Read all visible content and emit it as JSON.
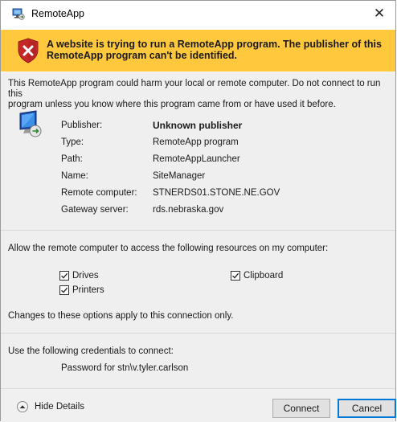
{
  "window": {
    "title": "RemoteApp",
    "close_glyph": "✕"
  },
  "banner": {
    "line1": "A website is trying to run a RemoteApp program. The publisher of this",
    "line2": "RemoteApp program can't be identified.",
    "color": "#ffc83d",
    "icon": "shield-error-icon"
  },
  "warning": {
    "line1": "This RemoteApp program could harm your local or remote computer. Do not connect to run this",
    "line2": "program unless you know where this program came from or have used it before."
  },
  "details": {
    "icon": "remote-computer-icon",
    "rows": [
      {
        "label": "Publisher:",
        "value": "Unknown publisher"
      },
      {
        "label": "Type:",
        "value": "RemoteApp program"
      },
      {
        "label": "Path:",
        "value": "RemoteAppLauncher"
      },
      {
        "label": "Name:",
        "value": "SiteManager"
      },
      {
        "label": "Remote computer:",
        "value": "STNERDS01.STONE.NE.GOV"
      },
      {
        "label": "Gateway server:",
        "value": "rds.nebraska.gov"
      }
    ]
  },
  "resources": {
    "heading": "Allow the remote computer to access the following resources on my computer:",
    "drives": {
      "label": "Drives",
      "checked": true
    },
    "printers": {
      "label": "Printers",
      "checked": true
    },
    "clipboard": {
      "label": "Clipboard",
      "checked": true
    },
    "note": "Changes to these options apply to this connection only."
  },
  "credentials": {
    "heading": "Use the following credentials to connect:",
    "value": "Password for stn\\v.tyler.carlson"
  },
  "footer": {
    "hide_details": "Hide Details",
    "connect": "Connect",
    "cancel": "Cancel"
  }
}
